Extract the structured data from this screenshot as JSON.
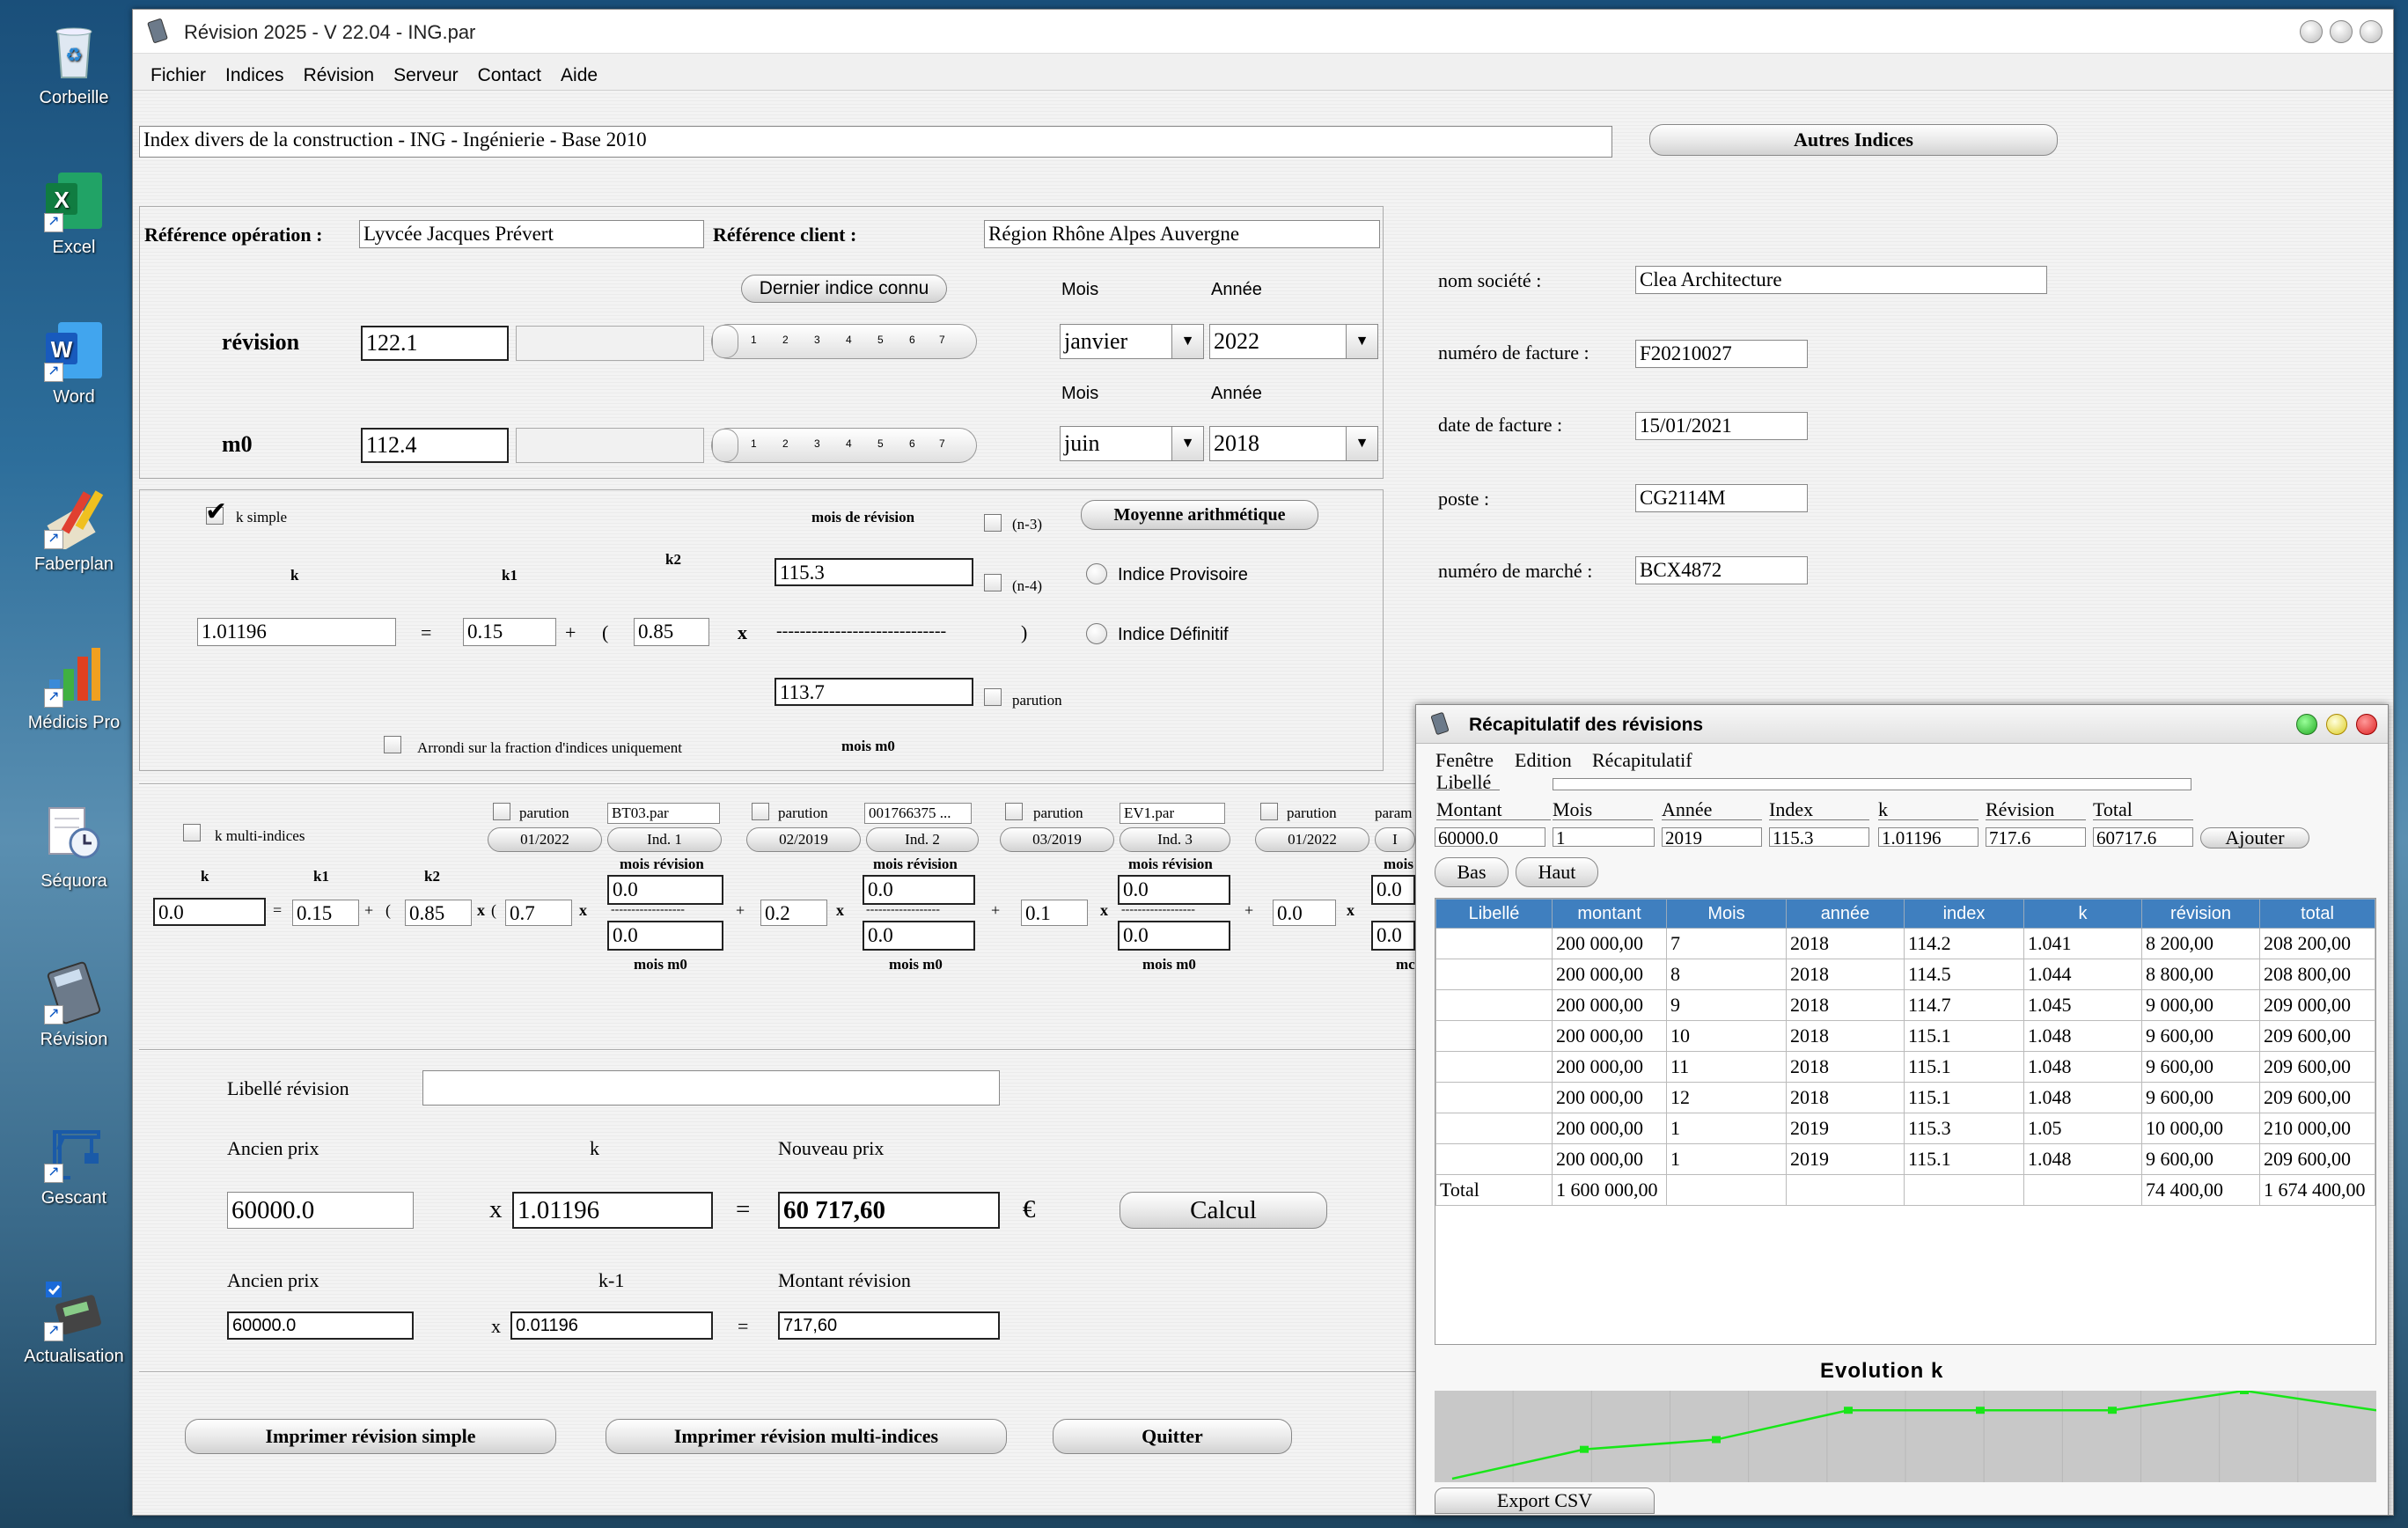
{
  "desktop": {
    "icons": [
      {
        "label": "Corbeille",
        "name": "recycle-bin-icon"
      },
      {
        "label": "Excel",
        "name": "excel-icon"
      },
      {
        "label": "Word",
        "name": "word-icon"
      },
      {
        "label": "Faberplan",
        "name": "faberplan-icon"
      },
      {
        "label": "Médicis Pro",
        "name": "medicis-pro-icon"
      },
      {
        "label": "Séquora",
        "name": "sequora-icon"
      },
      {
        "label": "Révision",
        "name": "revision-icon"
      },
      {
        "label": "Gescant",
        "name": "gescant-icon"
      },
      {
        "label": "Actualisation",
        "name": "actualisation-icon"
      }
    ]
  },
  "window": {
    "title": "Révision 2025 - V 22.04 - ING.par",
    "menu": [
      "Fichier",
      "Indices",
      "Révision",
      "Serveur",
      "Contact",
      "Aide"
    ]
  },
  "index": {
    "name": "Index divers de la construction - ING - Ingénierie - Base 2010",
    "other_button": "Autres Indices"
  },
  "references": {
    "operation_label": "Référence opération :",
    "operation_value": "Lyvcée Jacques Prévert",
    "client_label": "Référence client :",
    "client_value": "Région Rhône Alpes Auvergne",
    "last_index_button": "Dernier indice connu",
    "mois_label": "Mois",
    "annee_label": "Année"
  },
  "revision_row": {
    "label": "révision",
    "value": "122.1",
    "mois": "janvier",
    "annee": "2022"
  },
  "m0_row": {
    "label": "m0",
    "value": "112.4",
    "mois": "juin",
    "annee": "2018"
  },
  "slider_ticks": [
    "1",
    "2",
    "3",
    "4",
    "5",
    "6",
    "7"
  ],
  "company": {
    "societe_label": "nom société :",
    "societe_value": "Clea Architecture",
    "facture_label": "numéro de facture :",
    "facture_value": "F20210027",
    "date_label": "date de facture :",
    "date_value": "15/01/2021",
    "poste_label": "poste :",
    "poste_value": "CG2114M",
    "marche_label": "numéro de marché :",
    "marche_value": "BCX4872"
  },
  "ksimple": {
    "checkbox_label": "k simple",
    "k_label": "k",
    "k1_label": "k1",
    "k2_label": "k2",
    "k_value": "1.01196",
    "k1_value": "0.15",
    "k2_value": "0.85",
    "mois_revision_label": "mois de révision",
    "revision_index": "115.3",
    "m0_index": "113.7",
    "mois_m0_label": "mois m0",
    "n3": "(n-3)",
    "n4": "(n-4)",
    "parution": "parution",
    "moyenne_button": "Moyenne arithmétique",
    "provisoire": "Indice Provisoire",
    "definitif": "Indice Définitif",
    "arrondi": "Arrondi sur la fraction d'indices uniquement",
    "equals": "=",
    "plus": "+",
    "open": "(",
    "close": ")",
    "times": "x",
    "dashes": "-----------------------------"
  },
  "multi": {
    "checkbox_label": "k multi-indices",
    "k_label": "k",
    "k1_label": "k1",
    "k2_label": "k2",
    "k_value": "0.0",
    "k1_value": "0.15",
    "k2_value": "0.85",
    "mois_revision": "mois révision",
    "mois_m0": "mois m0",
    "dash_small": "------------------",
    "groups": [
      {
        "parution": "parution",
        "file": "BT03.par",
        "date": "01/2022",
        "ind": "Ind. 1",
        "coef": "0.7",
        "rev": "0.0",
        "m0": "0.0"
      },
      {
        "parution": "parution",
        "file": "001766375  ...",
        "date": "02/2019",
        "ind": "Ind. 2",
        "coef": "0.2",
        "rev": "0.0",
        "m0": "0.0"
      },
      {
        "parution": "parution",
        "file": "EV1.par",
        "date": "03/2019",
        "ind": "Ind. 3",
        "coef": "0.1",
        "rev": "0.0",
        "m0": "0.0"
      },
      {
        "parution": "parution",
        "file": "param",
        "date": "01/2022",
        "ind": "I",
        "coef": "0.0",
        "rev": "0.0",
        "m0": "0.0"
      }
    ],
    "mois_trunc": "mois",
    "mc_trunc": "mc"
  },
  "price": {
    "libelle_label": "Libellé révision",
    "libelle_value": "",
    "ancien_label": "Ancien prix",
    "k_label": "k",
    "nouveau_label": "Nouveau prix",
    "ancien_value": "60000.0",
    "k_value": "1.01196",
    "nouveau_value": "60 717,60",
    "euro": "€",
    "calcul_button": "Calcul",
    "ancien2_label": "Ancien prix",
    "km1_label": "k-1",
    "montant_label": "Montant révision",
    "ancien2_value": "60000.0",
    "km1_value": "0.01196",
    "montant_value": "717,60",
    "x": "x",
    "eq": "="
  },
  "bottom_buttons": {
    "print_simple": "Imprimer révision simple",
    "print_multi": "Imprimer révision multi-indices",
    "quit": "Quitter"
  },
  "recap": {
    "title": "Récapitulatif des révisions",
    "menu": [
      "Fenêtre",
      "Edition",
      "Récapitulatif"
    ],
    "libelle_label": "Libellé",
    "fields": [
      {
        "label": "Montant",
        "value": "60000.0"
      },
      {
        "label": "Mois",
        "value": "1"
      },
      {
        "label": "Année",
        "value": "2019"
      },
      {
        "label": "Index",
        "value": "115.3"
      },
      {
        "label": "k",
        "value": "1.01196"
      },
      {
        "label": "Révision",
        "value": "717.6"
      },
      {
        "label": "Total",
        "value": "60717.6"
      }
    ],
    "add_button": "Ajouter",
    "bas_button": "Bas",
    "haut_button": "Haut",
    "columns": [
      "Libellé",
      "montant",
      "Mois",
      "année",
      "index",
      "k",
      "révision",
      "total"
    ],
    "rows": [
      [
        "",
        "200 000,00",
        "7",
        "2018",
        "114.2",
        "1.041",
        "8 200,00",
        "208 200,00"
      ],
      [
        "",
        "200 000,00",
        "8",
        "2018",
        "114.5",
        "1.044",
        "8 800,00",
        "208 800,00"
      ],
      [
        "",
        "200 000,00",
        "9",
        "2018",
        "114.7",
        "1.045",
        "9 000,00",
        "209 000,00"
      ],
      [
        "",
        "200 000,00",
        "10",
        "2018",
        "115.1",
        "1.048",
        "9 600,00",
        "209 600,00"
      ],
      [
        "",
        "200 000,00",
        "11",
        "2018",
        "115.1",
        "1.048",
        "9 600,00",
        "209 600,00"
      ],
      [
        "",
        "200 000,00",
        "12",
        "2018",
        "115.1",
        "1.048",
        "9 600,00",
        "209 600,00"
      ],
      [
        "",
        "200 000,00",
        "1",
        "2019",
        "115.3",
        "1.05",
        "10 000,00",
        "210 000,00"
      ],
      [
        "",
        "200 000,00",
        "1",
        "2019",
        "115.1",
        "1.048",
        "9 600,00",
        "209 600,00"
      ]
    ],
    "total_row": [
      "Total",
      "1 600 000,00",
      "",
      "",
      "",
      "",
      "74 400,00",
      "1 674 400,00"
    ],
    "chart_title": "Evolution k",
    "export_button": "Export CSV"
  },
  "chart_data": {
    "type": "line",
    "title": "Evolution k",
    "values": [
      1.041,
      1.044,
      1.045,
      1.048,
      1.048,
      1.048,
      1.05,
      1.048
    ],
    "colors": {
      "line": "#19e619",
      "background": "#c8c8c8"
    }
  }
}
